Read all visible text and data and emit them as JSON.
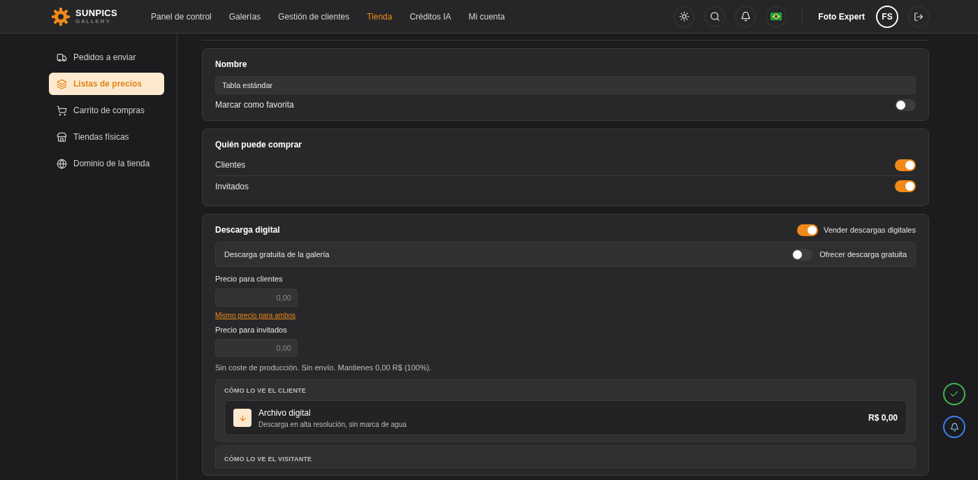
{
  "brand": {
    "name": "SUNPICS",
    "tagline": "GALLERY"
  },
  "nav": [
    {
      "label": "Panel de control",
      "selected": false
    },
    {
      "label": "Galerías",
      "selected": false
    },
    {
      "label": "Gestión de clientes",
      "selected": false
    },
    {
      "label": "Tienda",
      "selected": true
    },
    {
      "label": "Créditos IA",
      "selected": false
    },
    {
      "label": "Mi cuenta",
      "selected": false
    }
  ],
  "user": {
    "name": "Foto Expert",
    "initials": "FS"
  },
  "sidebar": {
    "items": [
      {
        "label": "Pedidos a enviar",
        "selected": false
      },
      {
        "label": "Listas de precios",
        "selected": true
      },
      {
        "label": "Carrito de compras",
        "selected": false
      },
      {
        "label": "Tiendas físicas",
        "selected": false
      },
      {
        "label": "Dominio de la tienda",
        "selected": false
      }
    ]
  },
  "name_card": {
    "title": "Nombre",
    "value": "Tabla estándar",
    "favorite": {
      "label": "Marcar como favorita",
      "on": false
    }
  },
  "buyers_card": {
    "title": "Quién puede comprar",
    "options": [
      {
        "label": "Clientes",
        "on": true
      },
      {
        "label": "Invitados",
        "on": true
      }
    ]
  },
  "digital_card": {
    "title": "Descarga digital",
    "sell": {
      "label": "Vender descargas digitales",
      "on": true
    },
    "free": {
      "title": "Descarga gratuita de la galería",
      "label": "Ofrecer descarga gratuita",
      "on": false
    },
    "client_price": {
      "label": "Precio para clientes",
      "placeholder": "0,00"
    },
    "same_price_link": "Mismo precio para ambos",
    "guest_price": {
      "label": "Precio para invitados",
      "placeholder": "0,00"
    },
    "note": "Sin coste de producción. Sin envío. Mantienes 0,00 R$ (100%).",
    "client_preview": {
      "heading": "CÓMO LO VE EL CLIENTE",
      "item": {
        "title": "Archivo digital",
        "subtitle": "Descarga en alta resolución, sin marca de agua",
        "price": "R$ 0,00"
      }
    },
    "visitor_preview": {
      "heading": "CÓMO LO VE EL VISITANTE"
    }
  }
}
